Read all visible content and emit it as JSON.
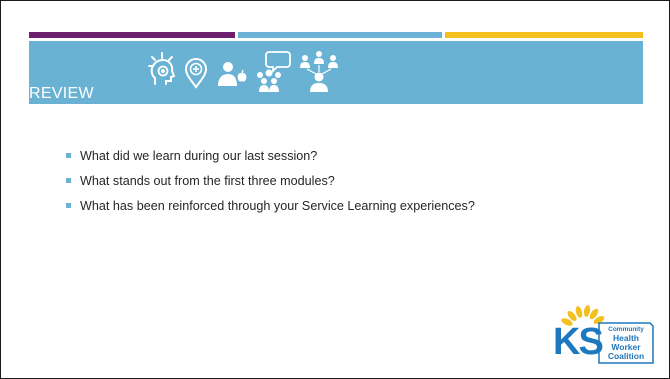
{
  "header": {
    "title": "REVIEW",
    "stripe_colors": [
      "#6b1f6e",
      "#6cb2d6",
      "#f4c01f"
    ],
    "banner_color": "#69b2d4",
    "icons": [
      "head-lightbulb-icon",
      "location-pin-plus-icon",
      "person-apple-icon",
      "group-chat-icon",
      "team-network-icon"
    ]
  },
  "bullets": [
    {
      "text": "What did we learn during our last session?"
    },
    {
      "text": "What stands out from the first three modules?"
    },
    {
      "text": "What has been reinforced through your Service Learning experiences?"
    }
  ],
  "logo": {
    "letters": "KS",
    "line1": "Community",
    "line2": "Health",
    "line3": "Worker",
    "line4": "Coalition",
    "colors": {
      "blue": "#1d78bd",
      "sun": "#f4c01f"
    }
  }
}
